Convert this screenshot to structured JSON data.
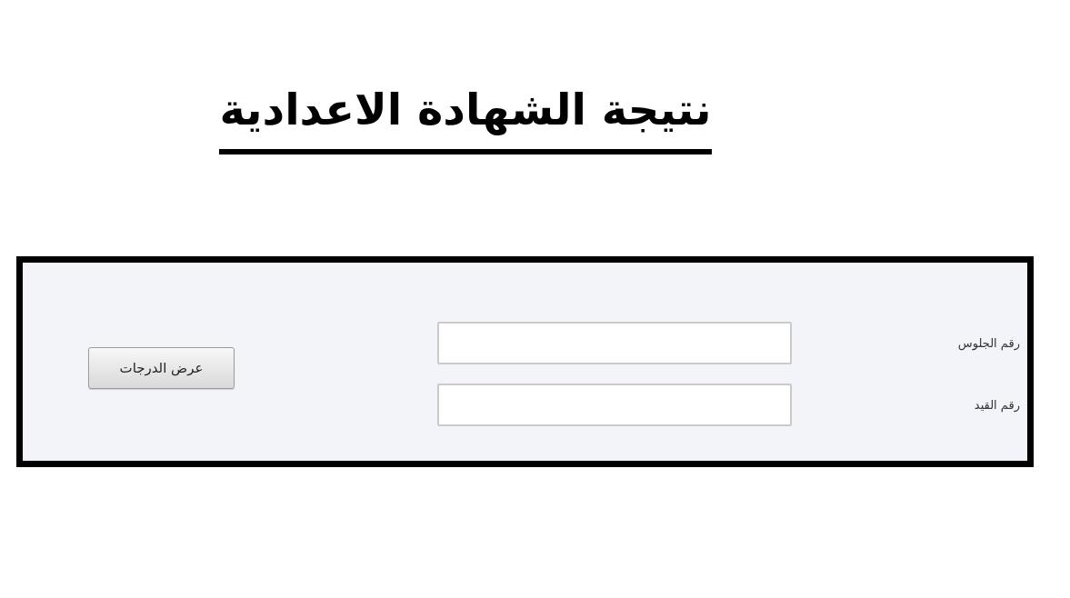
{
  "title": "نتيجة الشهادة الاعدادية",
  "form": {
    "fields": [
      {
        "label": "رقم الجلوس"
      },
      {
        "label": "رقم القيد"
      }
    ],
    "button": "عرض الدرجات"
  }
}
